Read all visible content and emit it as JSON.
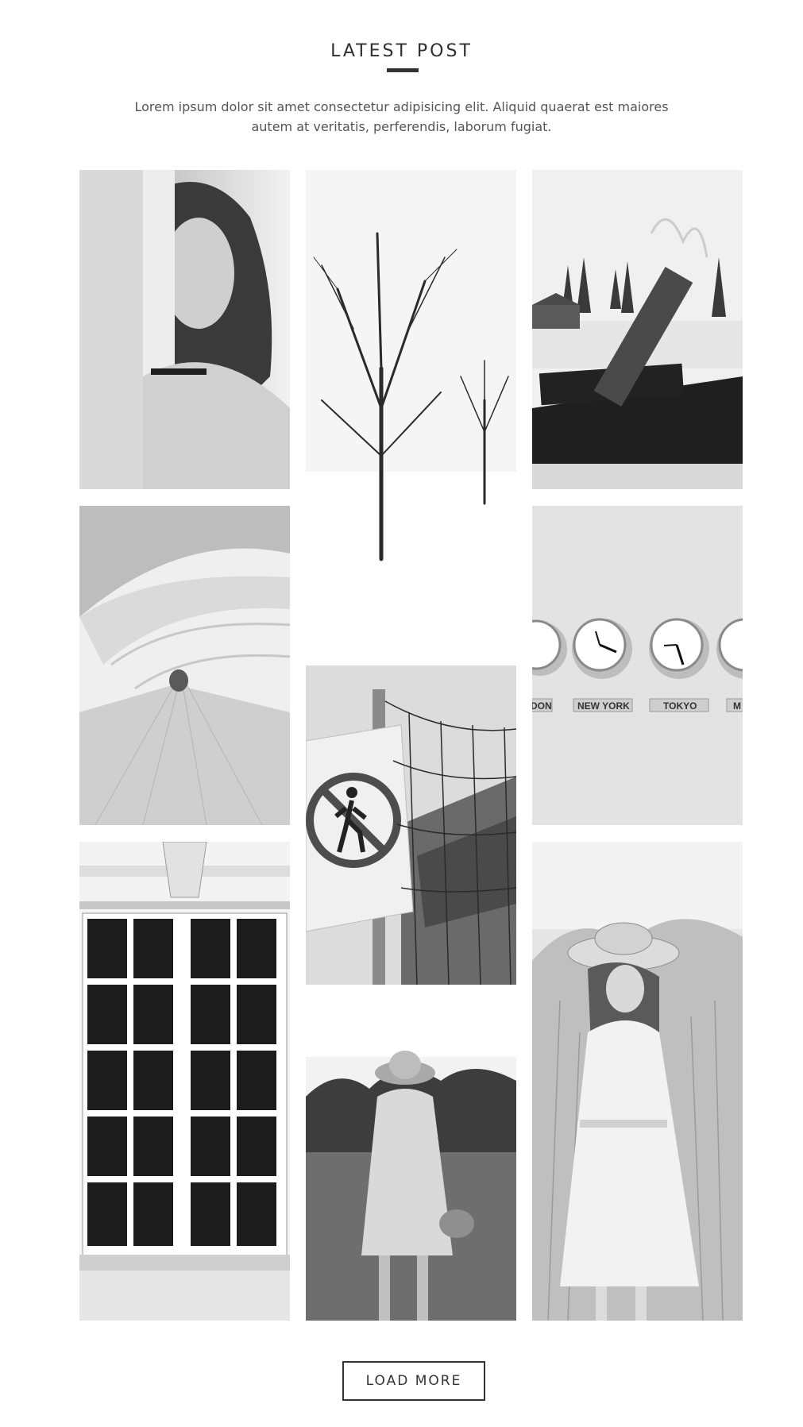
{
  "section": {
    "title": "LATEST POST",
    "intro": "Lorem ipsum dolor sit amet consectetur adipisicing elit. Aliquid quaerat est maiores autem at veritatis, perferendis, laborum fugiat."
  },
  "gallery": {
    "clock_labels": [
      "DON",
      "NEW YORK",
      "TOKYO",
      "M"
    ]
  },
  "load_more": {
    "label": "LOAD MORE"
  }
}
